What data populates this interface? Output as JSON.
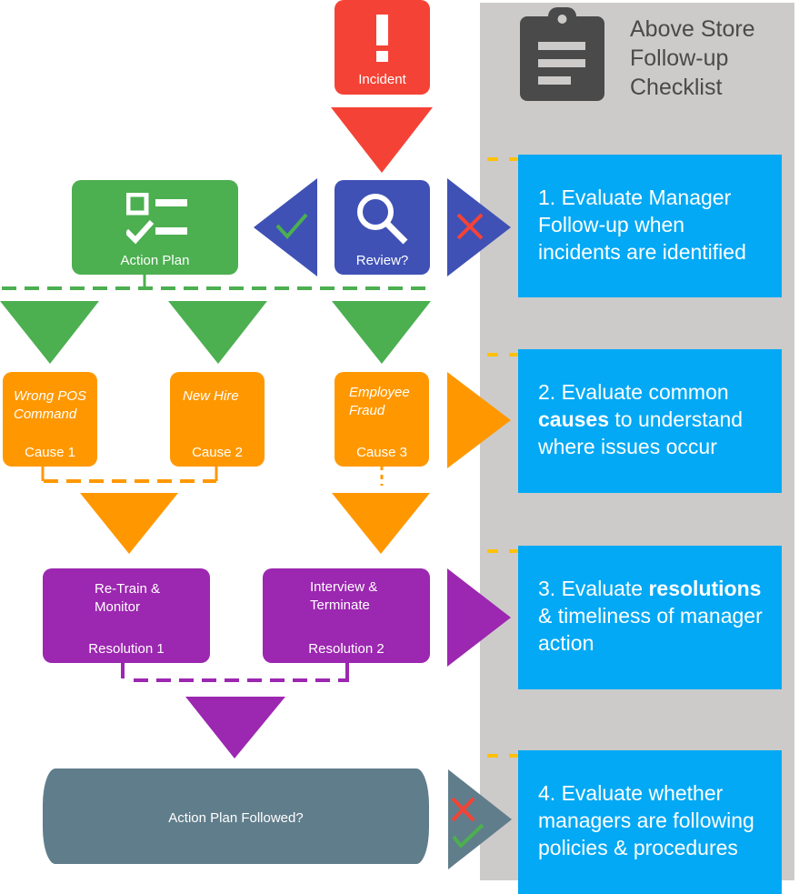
{
  "colors": {
    "incident": "#f44336",
    "review": "#3f51b5",
    "action_plan": "#4caf50",
    "cause": "#ff9800",
    "resolution": "#9c27b0",
    "final": "#607d8b",
    "checklist_box": "#03a9f4",
    "panel": "#cccbca",
    "dash_yellow": "#ffc107",
    "icon_dark": "#4a4a4a"
  },
  "checklist": {
    "icon": "clipboard-icon",
    "title_lines": [
      "Above Store",
      "Follow-up",
      "Checklist"
    ],
    "items": [
      {
        "pre": "1. Evaluate Manager Follow-up when incidents are identified",
        "bold": "",
        "post": ""
      },
      {
        "pre": "2. Evaluate common ",
        "bold": "causes",
        "post": " to understand where issues occur"
      },
      {
        "pre": "3. Evaluate ",
        "bold": "resolutions",
        "post": " & timeliness of manager action"
      },
      {
        "pre": "4. Evaluate whether managers are following policies & procedures",
        "bold": "",
        "post": ""
      }
    ]
  },
  "flow": {
    "incident": {
      "label": "Incident",
      "icon": "exclamation-icon"
    },
    "review": {
      "label": "Review?",
      "icon": "magnifier-icon",
      "yes_icon": "check-icon",
      "no_icon": "x-icon"
    },
    "action_plan": {
      "label": "Action Plan",
      "icon": "checklist-icon"
    },
    "causes": [
      {
        "desc_lines": [
          "Wrong POS",
          "Command"
        ],
        "label": "Cause 1"
      },
      {
        "desc_lines": [
          "New Hire"
        ],
        "label": "Cause 2"
      },
      {
        "desc_lines": [
          "Employee",
          "Fraud"
        ],
        "label": "Cause 3"
      }
    ],
    "resolutions": [
      {
        "desc_lines": [
          "Re-Train &",
          "Monitor"
        ],
        "label": "Resolution 1"
      },
      {
        "desc_lines": [
          "Interview &",
          "Terminate"
        ],
        "label": "Resolution 2"
      }
    ],
    "final": {
      "label": "Action Plan Followed?",
      "no_icon": "x-icon",
      "yes_icon": "check-icon"
    }
  }
}
